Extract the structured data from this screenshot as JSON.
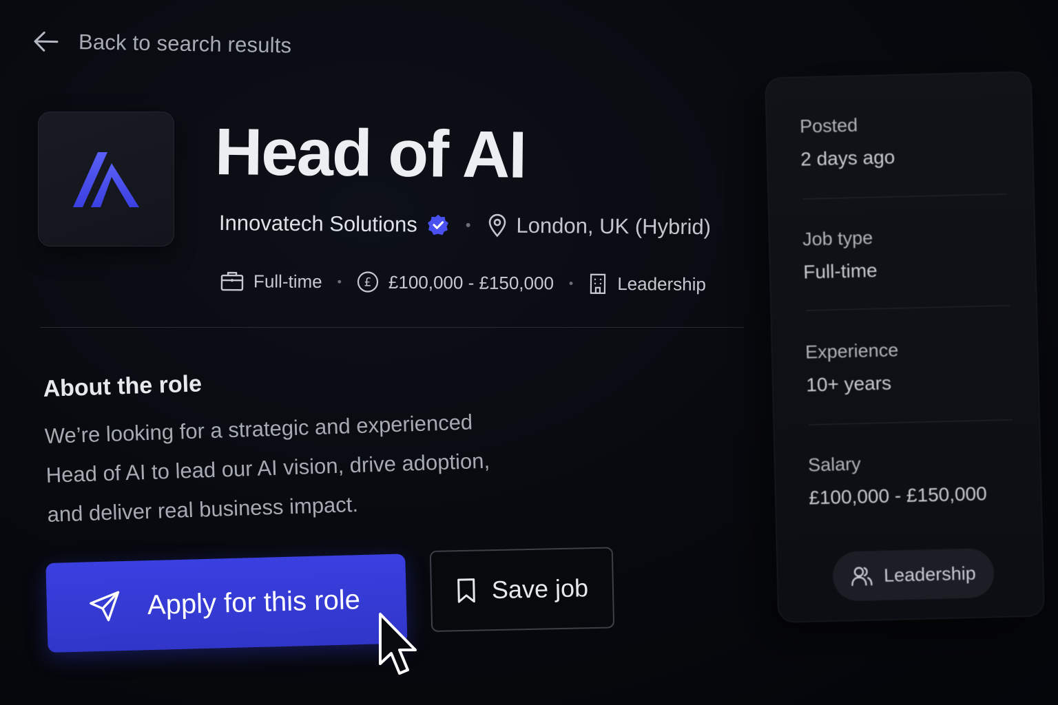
{
  "nav": {
    "back_label": "Back to search results"
  },
  "job": {
    "title": "Head of AI",
    "company": "Innovatech Solutions",
    "location": "London, UK (Hybrid)",
    "employment_type": "Full-time",
    "salary": "£100,000 - £150,000",
    "category": "Leadership"
  },
  "about": {
    "heading": "About the role",
    "body": "We’re looking for a strategic and experienced Head of AI to lead our AI vision, drive adoption, and deliver real business impact."
  },
  "actions": {
    "apply_label": "Apply for this role",
    "save_label": "Save job"
  },
  "details": {
    "posted_label": "Posted",
    "posted_value": "2 days ago",
    "job_type_label": "Job type",
    "job_type_value": "Full-time",
    "experience_label": "Experience",
    "experience_value": "10+ years",
    "salary_label": "Salary",
    "salary_value": "£100,000 - £150,000",
    "tag": "Leadership"
  },
  "icons": {
    "back": "arrow-left-icon",
    "logo": "company-logo",
    "verified": "verified-badge-icon",
    "location": "map-pin-icon",
    "employment": "briefcase-icon",
    "salary": "pound-coin-icon",
    "category": "building-icon",
    "apply": "send-icon",
    "save": "bookmark-icon",
    "tag": "users-icon",
    "cursor": "mouse-pointer-icon"
  },
  "colors": {
    "background": "#07090e",
    "accent": "#3a3fe0",
    "verified": "#4a50f0",
    "text": "#eceef2",
    "muted": "#a6aab2"
  }
}
